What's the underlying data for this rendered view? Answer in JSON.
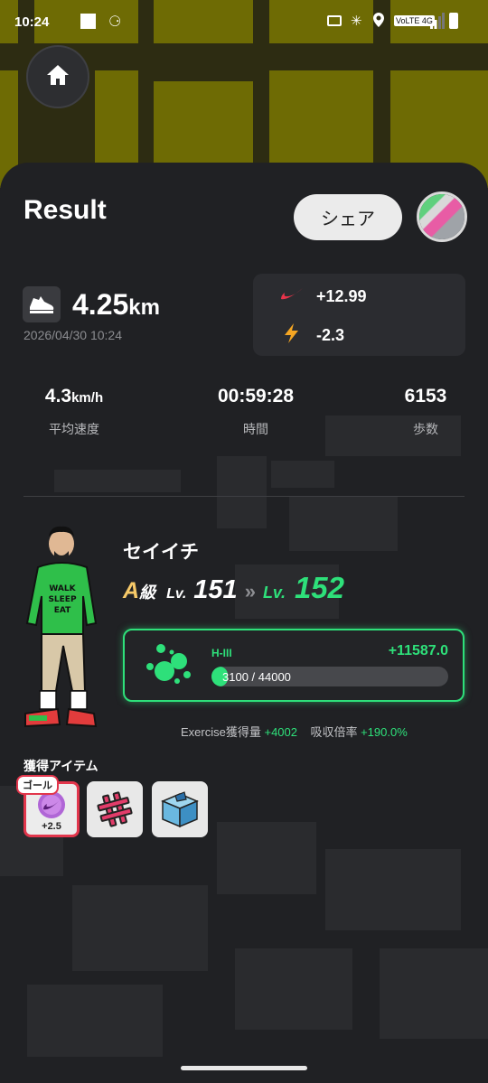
{
  "status_bar": {
    "time": "10:24",
    "network": "VoLTE 4G"
  },
  "nav": {
    "home_icon": "home-icon"
  },
  "result": {
    "title": "Result",
    "share_label": "シェア",
    "distance_value": "4.25",
    "distance_unit": "km",
    "datetime": "2026/04/30 10:24",
    "gains": [
      {
        "icon": "sneaker-swoosh-icon",
        "value": "+12.99",
        "color": "#e8334a"
      },
      {
        "icon": "lightning-icon",
        "value": "-2.3",
        "color": "#f5a623"
      }
    ]
  },
  "stats": [
    {
      "value": "4.3",
      "unit": "km/h",
      "label": "平均速度"
    },
    {
      "value": "00:59:28",
      "unit": "",
      "label": "時間"
    },
    {
      "value": "6153",
      "unit": "",
      "label": "歩数"
    }
  ],
  "character": {
    "name": "セイイチ",
    "rank": "A",
    "rank_suffix": "級",
    "lv_prefix": "Lv.",
    "level_from": "151",
    "level_to": "152",
    "shirt_text": "WALK SLEEP EAT"
  },
  "xp": {
    "rank_code": "H-III",
    "gain": "+11587.0",
    "progress_text": "3100 / 44000",
    "progress_fraction": 0.07
  },
  "exercise": {
    "label": "Exercise獲得量",
    "value": "+4002",
    "rate_label": "吸収倍率",
    "rate_value": "+190.0%"
  },
  "items": {
    "title": "獲得アイテム",
    "goal_tag": "ゴール",
    "list": [
      {
        "icon": "swoosh-orb-icon",
        "caption": "+2.5"
      },
      {
        "icon": "hashtag-badge-icon",
        "caption": ""
      },
      {
        "icon": "treasure-box-icon",
        "caption": ""
      }
    ]
  },
  "colors": {
    "accent": "#2ee07a",
    "sheet": "#202124",
    "map": "#6e6b04"
  }
}
